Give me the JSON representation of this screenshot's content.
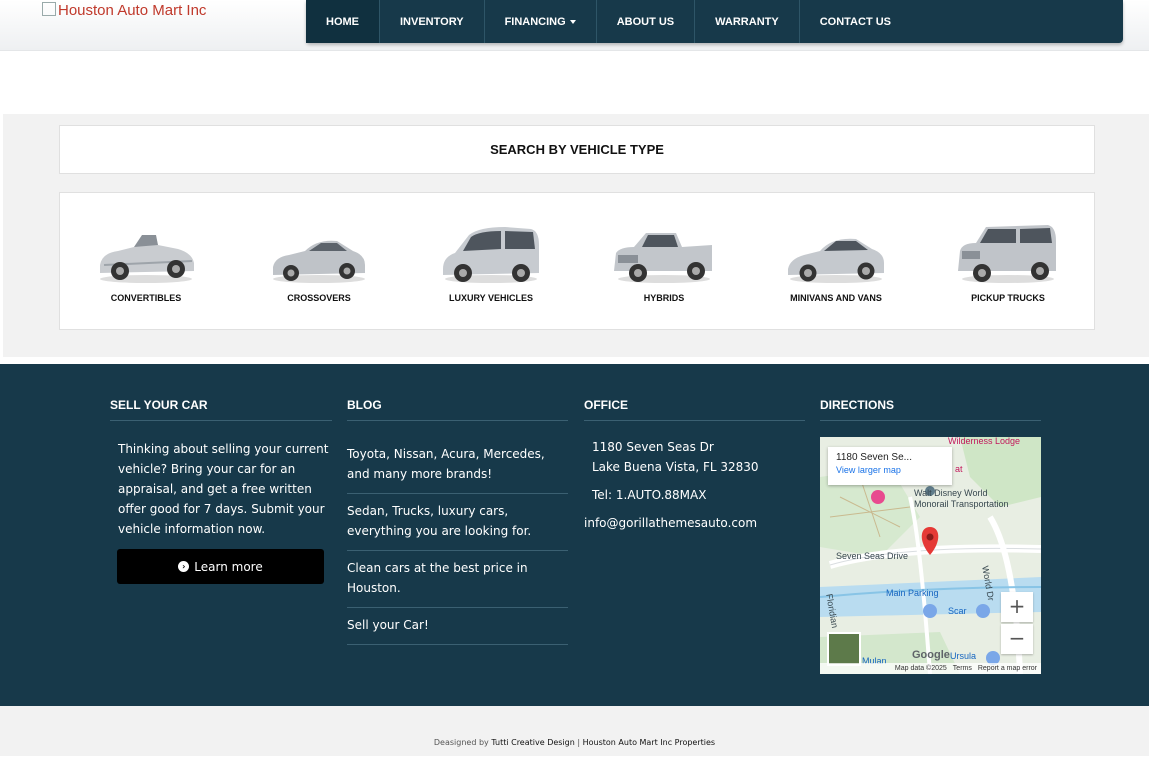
{
  "header": {
    "logo_alt": "Houston Auto Mart Inc",
    "nav": [
      {
        "label": "HOME"
      },
      {
        "label": "INVENTORY"
      },
      {
        "label": "FINANCING"
      },
      {
        "label": "ABOUT US"
      },
      {
        "label": "WARRANTY"
      },
      {
        "label": "CONTACT US"
      }
    ]
  },
  "vehicle_types": {
    "title": "SEARCH BY VEHICLE TYPE",
    "items": [
      {
        "label": "CONVERTIBLES",
        "icon": "convertible-car-icon"
      },
      {
        "label": "CROSSOVERS",
        "icon": "crossover-car-icon"
      },
      {
        "label": "LUXURY VEHICLES",
        "icon": "minivan-car-icon"
      },
      {
        "label": "HYBRIDS",
        "icon": "pickup-truck-icon"
      },
      {
        "label": "MINIVANS AND VANS",
        "icon": "sedan-car-icon"
      },
      {
        "label": "PICKUP TRUCKS",
        "icon": "suv-car-icon"
      }
    ]
  },
  "footer": {
    "sell": {
      "heading": "SELL YOUR CAR",
      "text": "Thinking about selling your current vehicle? Bring your car for an appraisal, and get a free written offer good for 7 days. Submit your vehicle information now.",
      "button_label": "Learn more"
    },
    "blog": {
      "heading": "BLOG",
      "items": [
        {
          "text": "Toyota, Nissan, Acura, Mercedes, and many more brands!"
        },
        {
          "text": "Sedan, Trucks, luxury cars, everything you are looking for."
        },
        {
          "text": "Clean cars at the best price in Houston."
        },
        {
          "text": "Sell your Car!"
        }
      ]
    },
    "office": {
      "heading": "OFFICE",
      "address_line1": "1180 Seven Seas Dr",
      "address_line2": "Lake Buena Vista, FL 32830",
      "phone": "Tel: 1.AUTO.88MAX",
      "email": "info@gorillathemesauto.com"
    },
    "directions": {
      "heading": "DIRECTIONS",
      "map": {
        "card_title": "1180 Seven Se...",
        "card_link": "View larger map",
        "labels": {
          "wilderness": "Wilderness Lodge",
          "at": "at",
          "disney_1": "Walt Disney World",
          "disney_2": "Monorail Transportation",
          "seven_seas": "Seven Seas Drive",
          "main_parking": "Main Parking",
          "scar": "Scar",
          "ursula": "Ursula",
          "mulan": "Mulan",
          "world_dr": "World Dr",
          "floridian": "Floridian",
          "google": "Google"
        },
        "zoom_in": "+",
        "zoom_out": "−",
        "data_notice": "Map data ©2025",
        "terms": "Terms",
        "report": "Report a map error"
      }
    }
  },
  "bottom": {
    "prefix": "Deasigned by",
    "designer": "Tutti Creative Design",
    "separator": "|",
    "company": "Houston Auto Mart Inc Properties"
  },
  "colors": {
    "nav_bg": "#17394a",
    "footer_bg": "#17394a",
    "section_bg": "#f2f2f2",
    "button_bg": "#000000",
    "link_blue": "#1a73e8"
  }
}
